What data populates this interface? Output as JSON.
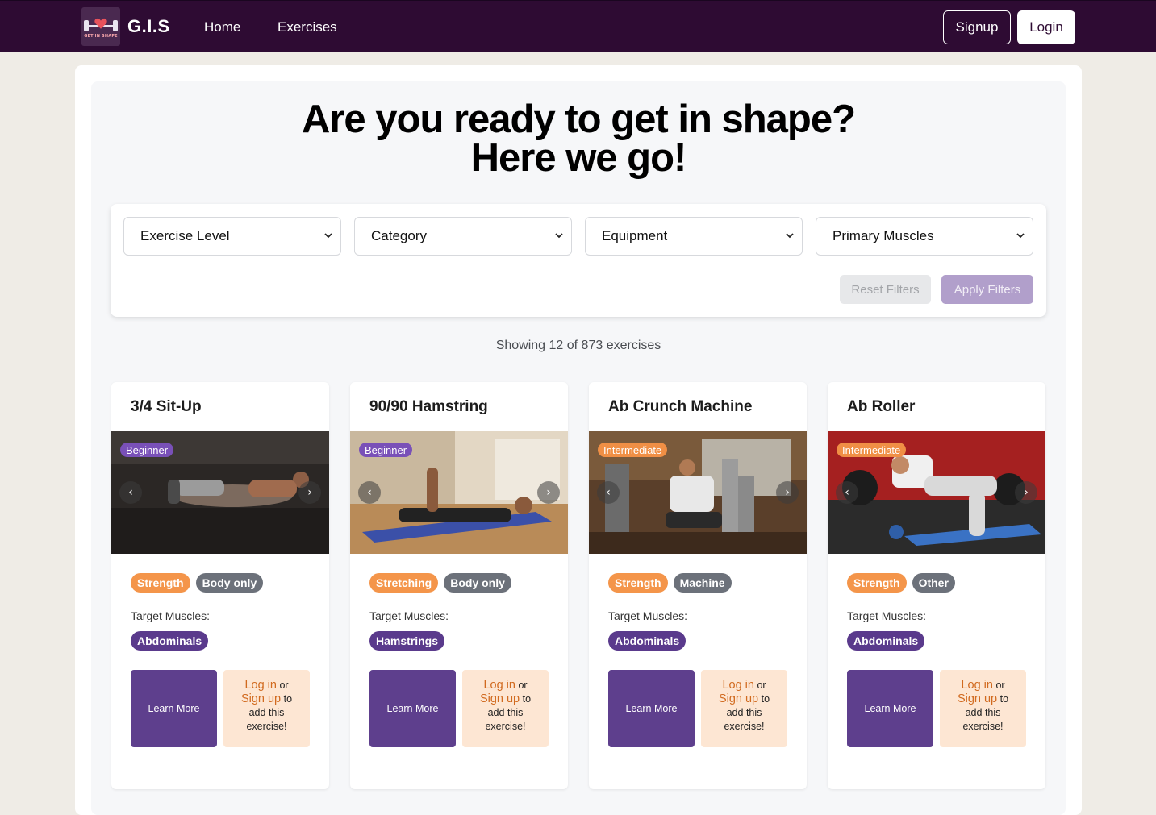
{
  "nav": {
    "logo_text": "GET IN SHAPE",
    "brand": "G.I.S",
    "links": [
      "Home",
      "Exercises"
    ],
    "signup": "Signup",
    "login": "Login"
  },
  "hero": {
    "line1": "Are you ready to get in shape?",
    "line2": "Here we go!"
  },
  "filters": {
    "selects": [
      "Exercise Level",
      "Category",
      "Equipment",
      "Primary Muscles"
    ],
    "reset": "Reset Filters",
    "apply": "Apply Filters"
  },
  "showing": "Showing 12 of 873 exercises",
  "cards": [
    {
      "title": "3/4 Sit-Up",
      "level": "Beginner",
      "category": "Strength",
      "equipment": "Body only",
      "target_label": "Target Muscles:",
      "muscle": "Abdominals",
      "learn": "Learn More",
      "login_link": "Log in",
      "or": "or",
      "signup_link": "Sign up",
      "to": "to",
      "add1": "add this",
      "add2": "exercise!"
    },
    {
      "title": "90/90 Hamstring",
      "level": "Beginner",
      "category": "Stretching",
      "equipment": "Body only",
      "target_label": "Target Muscles:",
      "muscle": "Hamstrings",
      "learn": "Learn More",
      "login_link": "Log in",
      "or": "or",
      "signup_link": "Sign up",
      "to": "to",
      "add1": "add this",
      "add2": "exercise!"
    },
    {
      "title": "Ab Crunch Machine",
      "level": "Intermediate",
      "category": "Strength",
      "equipment": "Machine",
      "target_label": "Target Muscles:",
      "muscle": "Abdominals",
      "learn": "Learn More",
      "login_link": "Log in",
      "or": "or",
      "signup_link": "Sign up",
      "to": "to",
      "add1": "add this",
      "add2": "exercise!"
    },
    {
      "title": "Ab Roller",
      "level": "Intermediate",
      "category": "Strength",
      "equipment": "Other",
      "target_label": "Target Muscles:",
      "muscle": "Abdominals",
      "learn": "Learn More",
      "login_link": "Log in",
      "or": "or",
      "signup_link": "Sign up",
      "to": "to",
      "add1": "add this",
      "add2": "exercise!"
    }
  ],
  "colors": {
    "nav_bg": "#2e0b33",
    "primary": "#5e3f8d",
    "accent": "#f4954a",
    "page_bg": "#efece6"
  }
}
